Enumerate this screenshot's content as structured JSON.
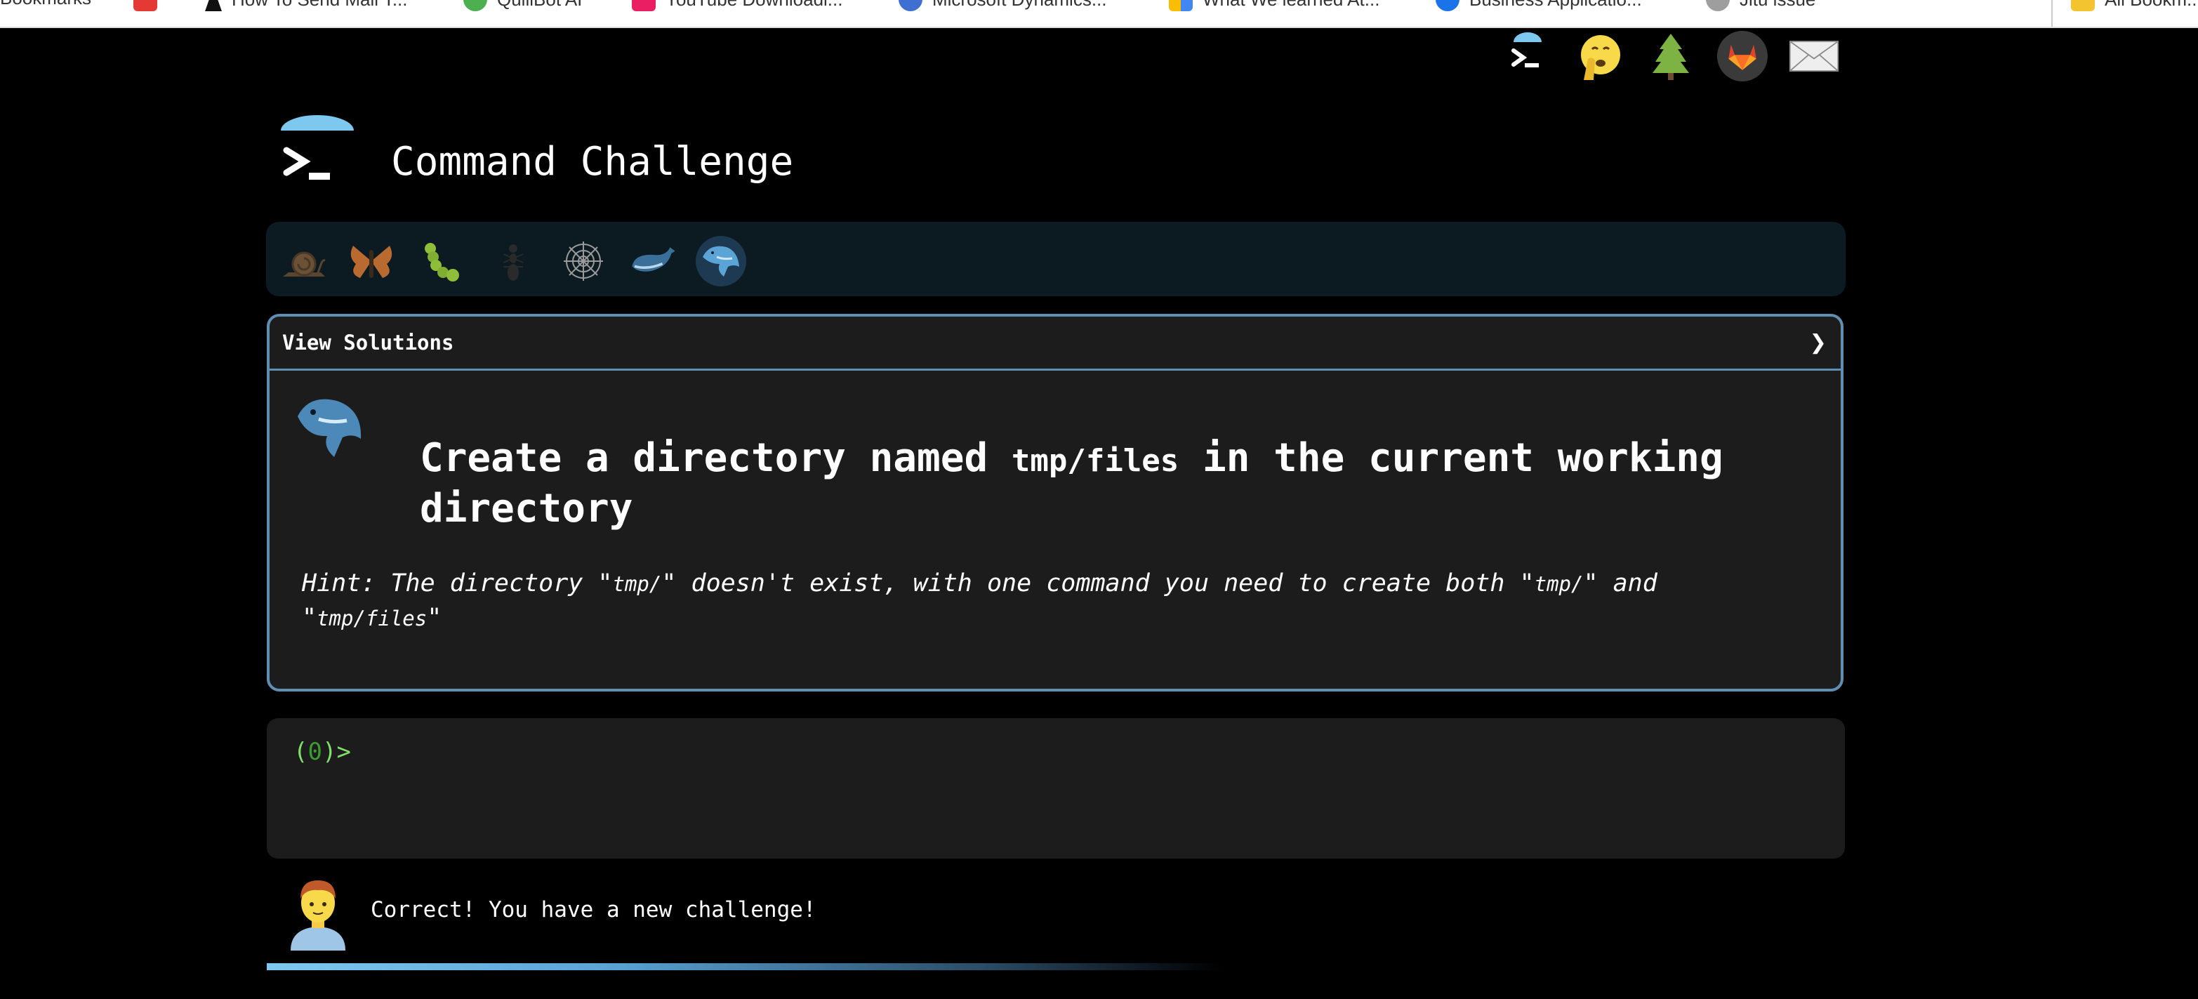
{
  "bookmarks": [
    {
      "label": "Bookmarks",
      "color": "#ffffff"
    },
    {
      "label": "How To Send Mail T...",
      "color": "#e53935"
    },
    {
      "label": "QuillBot AI",
      "color": "#4caf50"
    },
    {
      "label": "YouTube Downloadi...",
      "color": "#e91e63"
    },
    {
      "label": "Microsoft Dynamics...",
      "color": "#3f6fd1"
    },
    {
      "label": "What We learned At...",
      "color": "#fbbc04"
    },
    {
      "label": "Business Applicatio...",
      "color": "#1a73e8"
    },
    {
      "label": "Jitu issue",
      "color": "#9e9e9e"
    },
    {
      "label": "All Bookm...",
      "color": "#f4c430"
    }
  ],
  "top_icons": [
    {
      "name": "terminal-logo-icon"
    },
    {
      "name": "shush-face-icon"
    },
    {
      "name": "tree-icon"
    },
    {
      "name": "gitlab-icon"
    },
    {
      "name": "mail-icon"
    }
  ],
  "header": {
    "title": "Command Challenge"
  },
  "levels": [
    {
      "name": "snail-icon"
    },
    {
      "name": "butterfly-icon"
    },
    {
      "name": "caterpillar-icon"
    },
    {
      "name": "ant-icon"
    },
    {
      "name": "spider-web-icon"
    },
    {
      "name": "whale-icon"
    },
    {
      "name": "dolphin-icon"
    }
  ],
  "panel": {
    "view_solutions": "View Solutions",
    "chevron": "❯",
    "heading_part1": "Create a directory named ",
    "heading_code": "tmp/files",
    "heading_part2": " in the current working directory",
    "hint_part1": "Hint: The directory \"",
    "hint_code1": "tmp/",
    "hint_part2": "\" doesn't exist, with one command you need to create both \"",
    "hint_code2": "tmp/",
    "hint_part3": "\" and \"",
    "hint_code3": "tmp/files",
    "hint_part4": "\""
  },
  "terminal": {
    "prompt_open": "(",
    "prompt_count": "0",
    "prompt_close": ")>",
    "input_value": ""
  },
  "feedback": {
    "message": "Correct! You have a new challenge!"
  },
  "colors": {
    "accent": "#5e8fb0",
    "prompt_green": "#7ee06a",
    "panel_bg": "#1c1c1c",
    "levelbar_bg": "#0c1a22"
  }
}
